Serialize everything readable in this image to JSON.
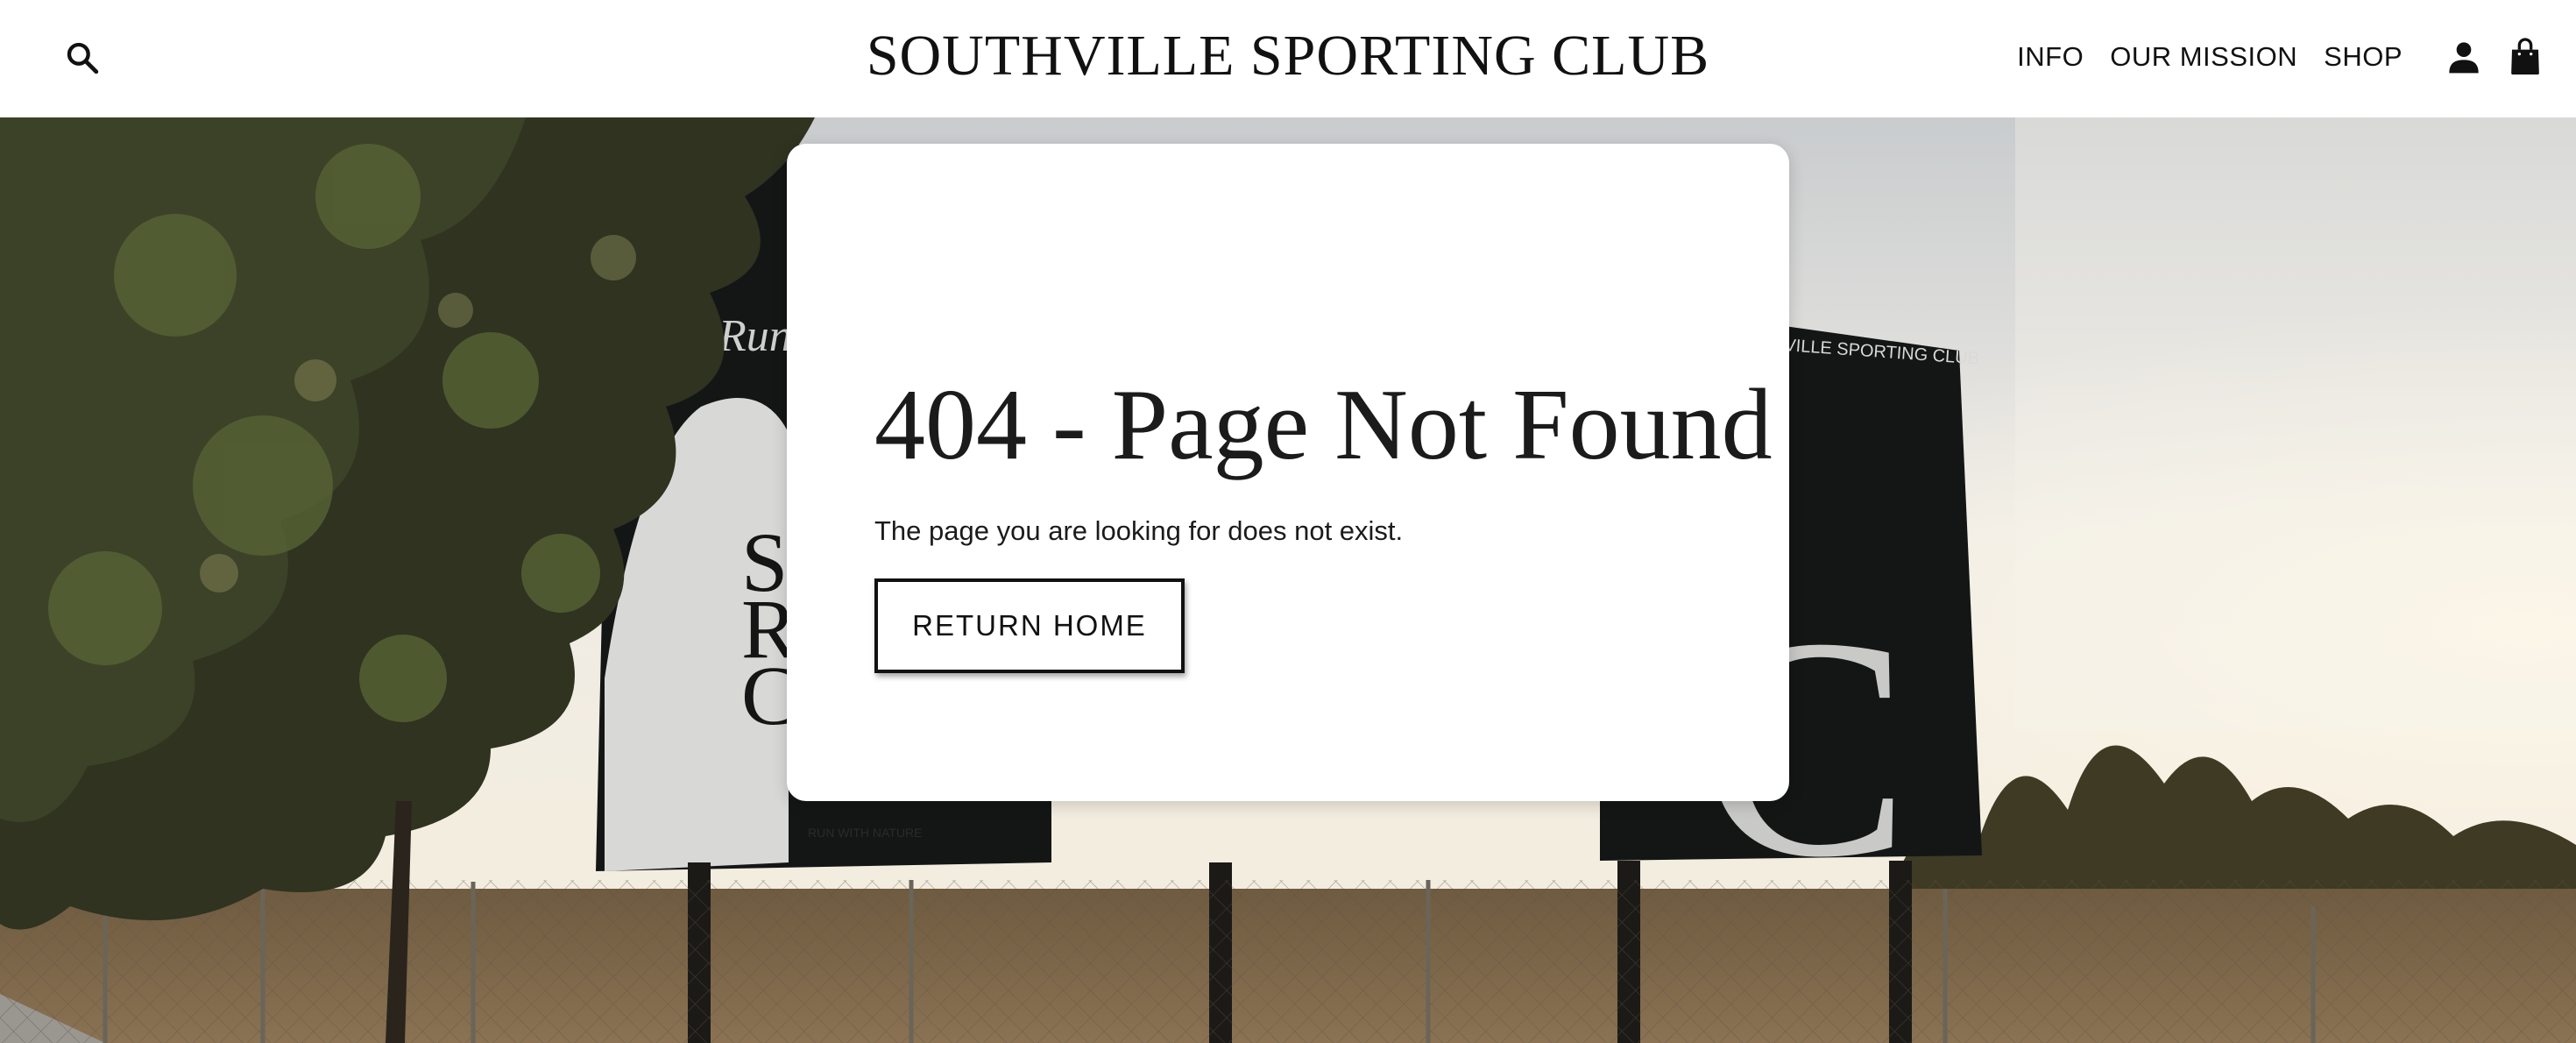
{
  "header": {
    "brand": "SOUTHVILLE SPORTING CLUB",
    "search_icon": "search-icon",
    "nav": [
      {
        "label": "INFO"
      },
      {
        "label": "OUR MISSION"
      },
      {
        "label": "SHOP"
      }
    ],
    "account_icon": "person-icon",
    "cart_icon": "shopping-bag-icon"
  },
  "hero": {
    "billboard_left_script": "Run",
    "billboard_left_letters": [
      "So",
      "Ru",
      "Cl"
    ],
    "billboard_left_tagline": "RUN WITH NATURE",
    "billboard_right_text": "VILLE SPORTING CLUB",
    "billboard_right_letter": "C"
  },
  "error": {
    "title": "404 - Page Not Found",
    "message": "The page you are looking for does not exist.",
    "button_label": "RETURN HOME"
  },
  "colors": {
    "text": "#111111",
    "card_bg": "#ffffff",
    "billboard": "#141616"
  }
}
